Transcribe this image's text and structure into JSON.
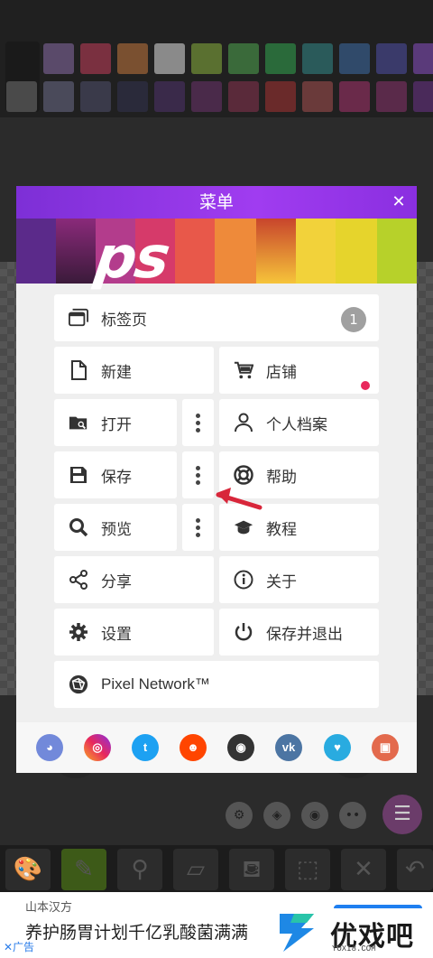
{
  "modal": {
    "title": "菜单",
    "close_icon": "close-icon",
    "logo_text": "ps",
    "items": {
      "tabs": {
        "label": "标签页",
        "icon": "tabs-icon",
        "badge": "1"
      },
      "new": {
        "label": "新建",
        "icon": "file-icon"
      },
      "shop": {
        "label": "店铺",
        "icon": "cart-icon",
        "notification_color": "#e8285c"
      },
      "open": {
        "label": "打开",
        "icon": "folder-search-icon"
      },
      "profile": {
        "label": "个人档案",
        "icon": "person-icon"
      },
      "save": {
        "label": "保存",
        "icon": "floppy-icon"
      },
      "help": {
        "label": "帮助",
        "icon": "lifebuoy-icon"
      },
      "preview": {
        "label": "预览",
        "icon": "magnifier-icon"
      },
      "tutorial": {
        "label": "教程",
        "icon": "graduation-cap-icon"
      },
      "share": {
        "label": "分享",
        "icon": "share-icon"
      },
      "about": {
        "label": "关于",
        "icon": "info-icon"
      },
      "settings": {
        "label": "设置",
        "icon": "gear-icon"
      },
      "save_exit": {
        "label": "保存并退出",
        "icon": "power-icon"
      },
      "network": {
        "label": "Pixel Network™",
        "icon": "network-globe-icon"
      }
    },
    "social": [
      {
        "name": "discord",
        "icon": "discord-icon",
        "color": "#7289da"
      },
      {
        "name": "instagram",
        "icon": "instagram-icon",
        "color": "#d6249f"
      },
      {
        "name": "twitter",
        "icon": "twitter-icon",
        "color": "#1da1f2"
      },
      {
        "name": "reddit",
        "icon": "reddit-icon",
        "color": "#ff4500"
      },
      {
        "name": "github",
        "icon": "github-icon",
        "color": "#333333"
      },
      {
        "name": "vk",
        "icon": "vk-icon",
        "color": "#4c75a3"
      },
      {
        "name": "kofi",
        "icon": "kofi-icon",
        "color": "#29abe0"
      },
      {
        "name": "pixel-game",
        "icon": "gameboy-icon",
        "color": "#e36a4d"
      }
    ]
  },
  "ad": {
    "brand": "山本汉方",
    "text": "养护肠胃计划千亿乳酸菌满满",
    "tag": "✕广告"
  },
  "watermark": {
    "name": "优戏吧",
    "url": "YOXI8.COM"
  },
  "colors": {
    "accent_purple": "#8a2fe0",
    "annotation_arrow": "#d8263a"
  }
}
